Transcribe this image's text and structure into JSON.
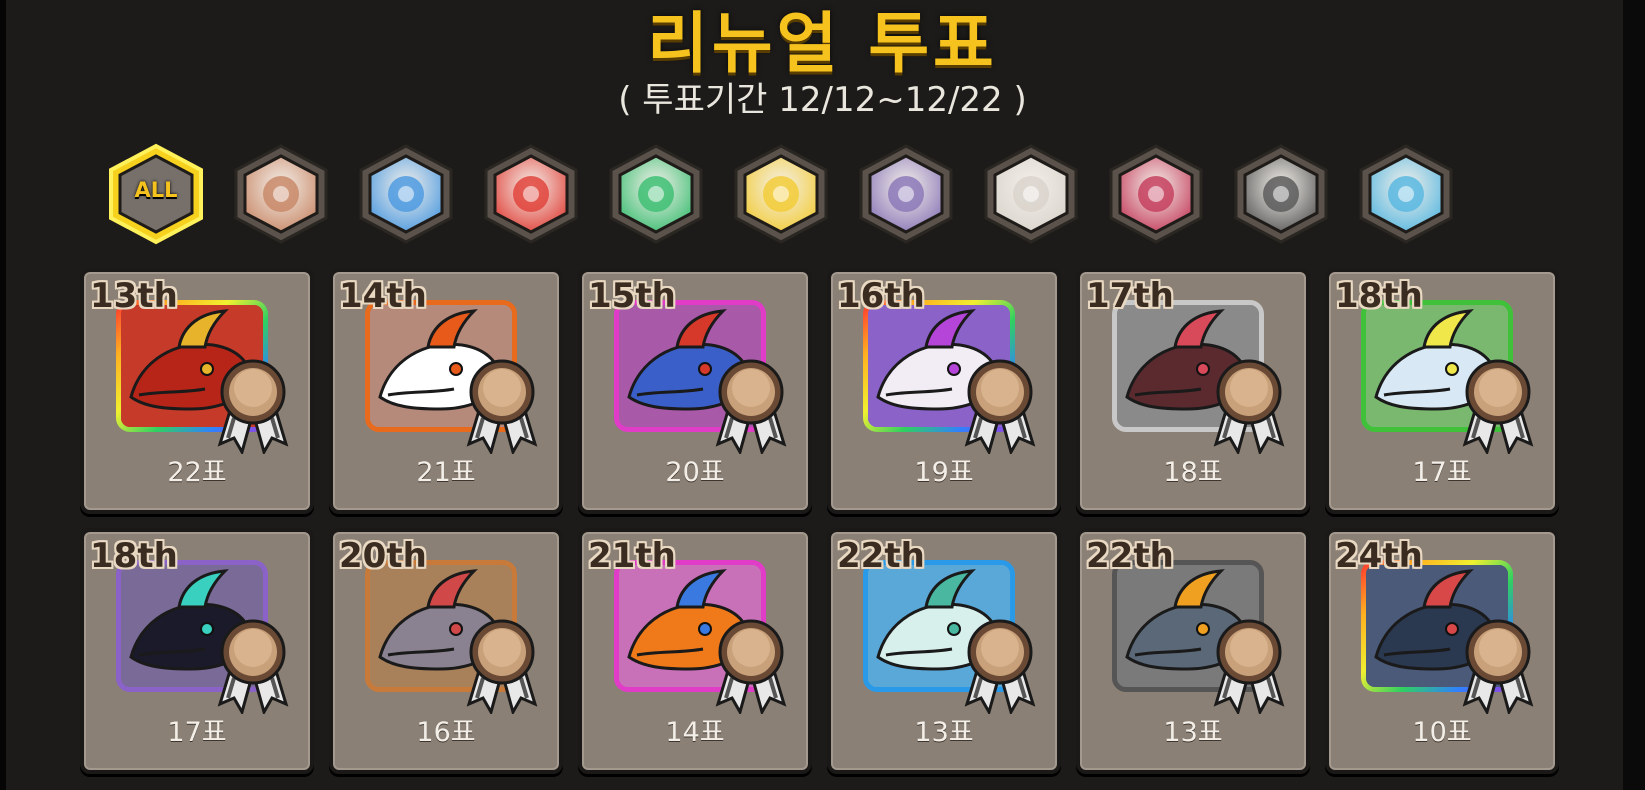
{
  "header": {
    "title": "리뉴얼 투표",
    "period": "( 투표기간 12/12~12/22 )"
  },
  "filters": [
    {
      "key": "all",
      "label": "ALL",
      "icon": "all-icon",
      "color": "#6f6b66",
      "selected": true
    },
    {
      "key": "earth",
      "label": "",
      "icon": "earth-element-icon",
      "color": "#c98a6a",
      "selected": false
    },
    {
      "key": "water",
      "label": "",
      "icon": "water-element-icon",
      "color": "#4f9be0",
      "selected": false
    },
    {
      "key": "fire",
      "label": "",
      "icon": "fire-element-icon",
      "color": "#e0443c",
      "selected": false
    },
    {
      "key": "wind",
      "label": "",
      "icon": "wind-element-icon",
      "color": "#3fbf74",
      "selected": false
    },
    {
      "key": "light",
      "label": "",
      "icon": "light-element-icon",
      "color": "#f2cc3a",
      "selected": false
    },
    {
      "key": "dark",
      "label": "",
      "icon": "dark-element-icon",
      "color": "#8c79b8",
      "selected": false
    },
    {
      "key": "holy",
      "label": "",
      "icon": "holy-element-icon",
      "color": "#d9d4cc",
      "selected": false
    },
    {
      "key": "chaos",
      "label": "",
      "icon": "chaos-element-icon",
      "color": "#c5415f",
      "selected": false
    },
    {
      "key": "shadow",
      "label": "",
      "icon": "shadow-element-icon",
      "color": "#5c5c5c",
      "selected": false
    },
    {
      "key": "rainbow",
      "label": "",
      "icon": "rainbow-element-icon",
      "color": "#5ab8e0",
      "selected": false
    }
  ],
  "candidates": [
    {
      "rank": "13th",
      "votes": "22표",
      "frame": "rainbow",
      "bg": "#c63a2a",
      "creature": "#b72418",
      "accent": "#e6b32a",
      "icon": "fire-dragon-portrait"
    },
    {
      "rank": "14th",
      "votes": "21표",
      "frame": "#e86a1c",
      "bg": "#b58a7a",
      "creature": "#ffffff",
      "accent": "#e85a1a",
      "icon": "white-dragon-portrait"
    },
    {
      "rank": "15th",
      "votes": "20표",
      "frame": "#e03cc8",
      "bg": "#a85aa8",
      "creature": "#3b5fc8",
      "accent": "#d6382a",
      "icon": "blue-dragon-portrait"
    },
    {
      "rank": "16th",
      "votes": "19표",
      "frame": "rainbow",
      "bg": "#8a62c8",
      "creature": "#f2ecf4",
      "accent": "#b545d8",
      "icon": "ram-dragon-portrait"
    },
    {
      "rank": "17th",
      "votes": "18표",
      "frame": "#c8c8c8",
      "bg": "#8a8a8a",
      "creature": "#5a2a2e",
      "accent": "#d84a5a",
      "icon": "dark-dragon-portrait"
    },
    {
      "rank": "18th",
      "votes": "17표",
      "frame": "#3fc23a",
      "bg": "#7ab870",
      "creature": "#d8e8f4",
      "accent": "#f0e84a",
      "icon": "wing-dragon-portrait"
    },
    {
      "rank": "18th",
      "votes": "17표",
      "frame": "#8a62c8",
      "bg": "#7a6a98",
      "creature": "#1a1a2a",
      "accent": "#3ad0c0",
      "icon": "shadow-dragon-portrait"
    },
    {
      "rank": "20th",
      "votes": "16표",
      "frame": "#c87a3a",
      "bg": "#a8805a",
      "creature": "#8a8290",
      "accent": "#d04848",
      "icon": "stone-dragon-portrait"
    },
    {
      "rank": "21th",
      "votes": "14표",
      "frame": "#e03cc8",
      "bg": "#c870b8",
      "creature": "#f07a1a",
      "accent": "#3a7ae0",
      "icon": "orange-dragon-portrait"
    },
    {
      "rank": "22th",
      "votes": "13표",
      "frame": "#2a9ae8",
      "bg": "#5aa8d8",
      "creature": "#d8f0ec",
      "accent": "#4ab8a0",
      "icon": "serpent-dragon-portrait"
    },
    {
      "rank": "22th",
      "votes": "13표",
      "frame": "#555555",
      "bg": "#7a7a7a",
      "creature": "#5a6878",
      "accent": "#f0a020",
      "icon": "rock-dragon-portrait"
    },
    {
      "rank": "24th",
      "votes": "10표",
      "frame": "rainbow",
      "bg": "#4a5a78",
      "creature": "#2a3850",
      "accent": "#d84848",
      "icon": "ice-dragon-portrait"
    }
  ]
}
